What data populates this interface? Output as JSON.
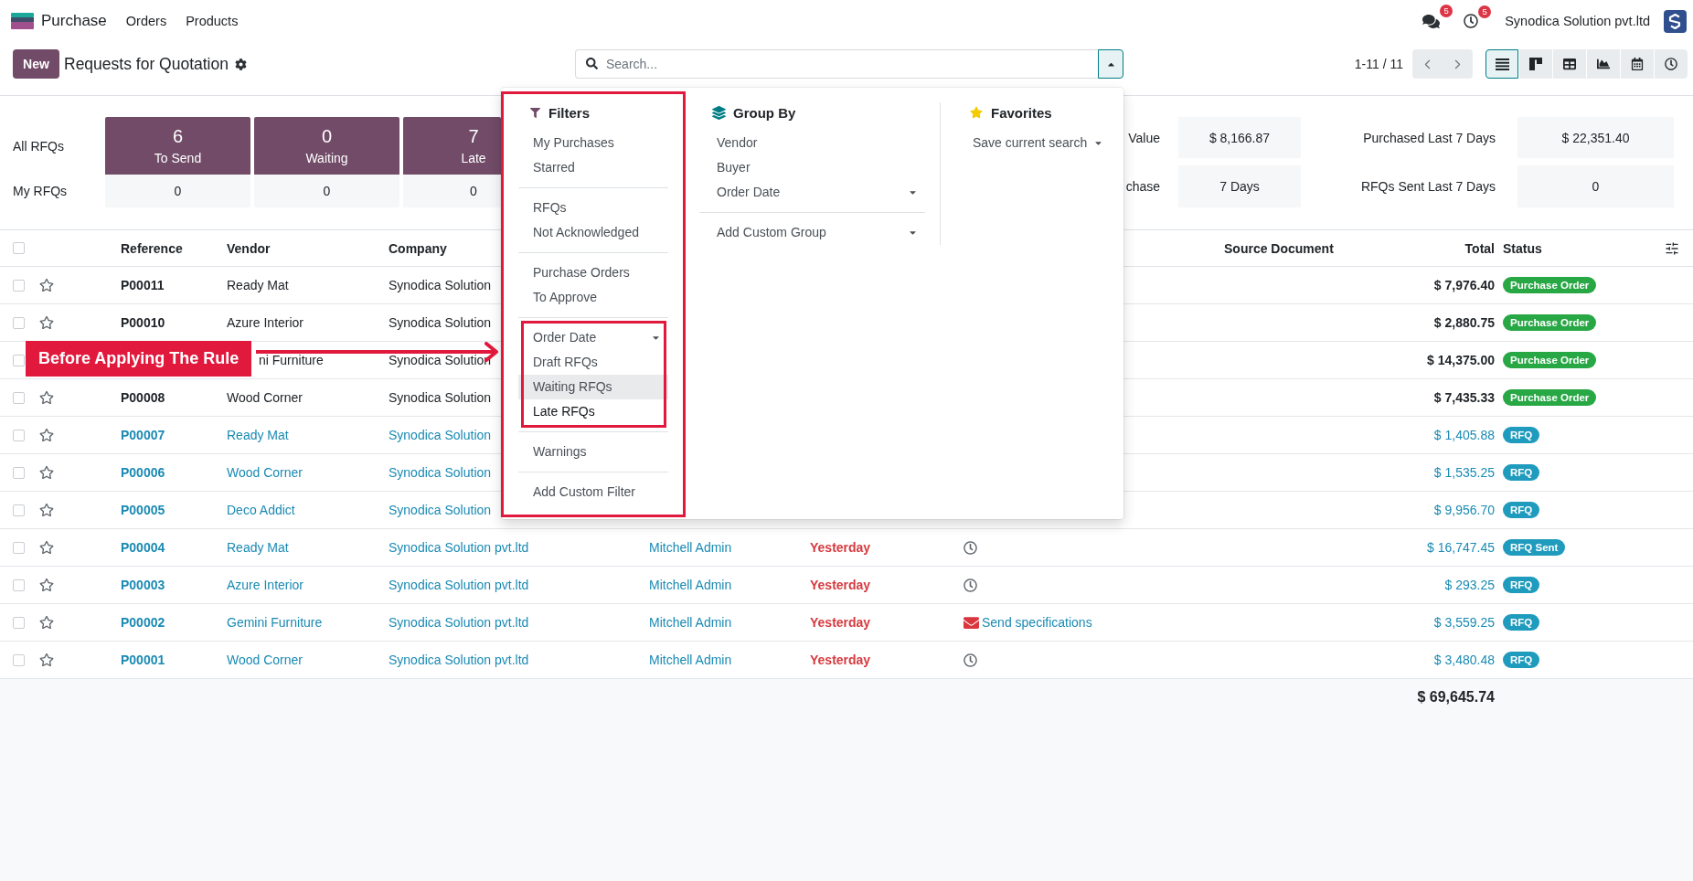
{
  "navbar": {
    "app_name": "Purchase",
    "menu": [
      "Orders",
      "Products"
    ],
    "messages_badge": "5",
    "activities_badge": "5",
    "company": "Synodica Solution pvt.ltd"
  },
  "control_panel": {
    "new_button": "New",
    "title": "Requests for Quotation",
    "search": {
      "placeholder": "Search...",
      "expanded": true
    },
    "pager": "1-11 / 11",
    "views": [
      {
        "kind": "list",
        "selected": true
      },
      {
        "kind": "kanban",
        "selected": false
      },
      {
        "kind": "pivot",
        "selected": false
      },
      {
        "kind": "graph",
        "selected": false
      },
      {
        "kind": "calendar",
        "selected": false
      },
      {
        "kind": "activity",
        "selected": false
      }
    ]
  },
  "dashboard": {
    "all_label": "All RFQs",
    "my_label": "My RFQs",
    "tiles": [
      {
        "count": "6",
        "label": "To Send",
        "mine": "0"
      },
      {
        "count": "0",
        "label": "Waiting",
        "mine": "0"
      },
      {
        "count": "7",
        "label": "Late",
        "mine": "0"
      }
    ],
    "stats": [
      {
        "label": "Value",
        "value": "$ 8,166.87"
      },
      {
        "label": "Purchased Last 7 Days",
        "value": "$ 22,351.40"
      },
      {
        "label": "chase",
        "value": "7 Days"
      },
      {
        "label": "RFQs Sent Last 7 Days",
        "value": "0"
      }
    ]
  },
  "table": {
    "select_all": {
      "checked": false
    },
    "columns": {
      "reference": "Reference",
      "vendor": "Vendor",
      "company": "Company",
      "source_document": "Source Document",
      "total": "Total",
      "status": "Status"
    },
    "rows": [
      {
        "kind": "order",
        "checked": false,
        "starred": false,
        "reference": "P00011",
        "vendor": "Ready Mat",
        "company": "Synodica Solution",
        "total": "$ 7,976.40",
        "status": "Purchase Order"
      },
      {
        "kind": "order",
        "checked": false,
        "starred": false,
        "reference": "P00010",
        "vendor": "Azure Interior",
        "company": "Synodica Solution",
        "total": "$ 2,880.75",
        "status": "Purchase Order"
      },
      {
        "kind": "order",
        "checked": false,
        "vendor": "ni Furniture",
        "company": "Synodica Solution",
        "total": "$ 14,375.00",
        "status": "Purchase Order"
      },
      {
        "kind": "order",
        "checked": false,
        "starred": false,
        "reference": "P00008",
        "vendor": "Wood Corner",
        "company": "Synodica Solution",
        "total": "$ 7,435.33",
        "status": "Purchase Order"
      },
      {
        "kind": "rfq",
        "checked": false,
        "starred": false,
        "reference": "P00007",
        "vendor": "Ready Mat",
        "company": "Synodica Solution",
        "total": "$ 1,405.88",
        "status": "RFQ"
      },
      {
        "kind": "rfq",
        "checked": false,
        "starred": false,
        "reference": "P00006",
        "vendor": "Wood Corner",
        "company": "Synodica Solution",
        "total": "$ 1,535.25",
        "status": "RFQ"
      },
      {
        "kind": "rfq",
        "checked": false,
        "starred": false,
        "reference": "P00005",
        "vendor": "Deco Addict",
        "company": "Synodica Solution",
        "total": "$ 9,956.70",
        "status": "RFQ"
      },
      {
        "kind": "rfq",
        "checked": false,
        "starred": false,
        "reference": "P00004",
        "vendor": "Ready Mat",
        "company": "Synodica Solution pvt.ltd",
        "buyer": "Mitchell Admin",
        "deadline": "Yesterday",
        "activity": {
          "kind": "clock"
        },
        "total": "$ 16,747.45",
        "status": "RFQ Sent"
      },
      {
        "kind": "rfq",
        "checked": false,
        "starred": false,
        "reference": "P00003",
        "vendor": "Azure Interior",
        "company": "Synodica Solution pvt.ltd",
        "buyer": "Mitchell Admin",
        "deadline": "Yesterday",
        "activity": {
          "kind": "clock"
        },
        "total": "$ 293.25",
        "status": "RFQ"
      },
      {
        "kind": "rfq",
        "checked": false,
        "starred": false,
        "reference": "P00002",
        "vendor": "Gemini Furniture",
        "company": "Synodica Solution pvt.ltd",
        "buyer": "Mitchell Admin",
        "deadline": "Yesterday",
        "activity": {
          "kind": "email",
          "summary": "Send specifications"
        },
        "total": "$ 3,559.25",
        "status": "RFQ"
      },
      {
        "kind": "rfq",
        "checked": false,
        "starred": false,
        "reference": "P00001",
        "vendor": "Wood Corner",
        "company": "Synodica Solution pvt.ltd",
        "buyer": "Mitchell Admin",
        "deadline": "Yesterday",
        "activity": {
          "kind": "clock"
        },
        "total": "$ 3,480.48",
        "status": "RFQ"
      }
    ],
    "footer_total": "$ 69,645.74"
  },
  "search_panel": {
    "filters": {
      "title": "Filters",
      "outlined": true,
      "groups": [
        {
          "outlined": false,
          "items": [
            {
              "label": "My Purchases",
              "submenu": false,
              "focused": false,
              "hovered": false
            },
            {
              "label": "Starred",
              "submenu": false,
              "focused": false,
              "hovered": false
            }
          ]
        },
        {
          "outlined": false,
          "items": [
            {
              "label": "RFQs",
              "submenu": false,
              "focused": false,
              "hovered": false
            },
            {
              "label": "Not Acknowledged",
              "submenu": false,
              "focused": false,
              "hovered": false
            }
          ]
        },
        {
          "outlined": false,
          "items": [
            {
              "label": "Purchase Orders",
              "submenu": false,
              "focused": false,
              "hovered": false
            },
            {
              "label": "To Approve",
              "submenu": false,
              "focused": false,
              "hovered": false
            }
          ]
        },
        {
          "outlined": true,
          "items": [
            {
              "label": "Order Date",
              "submenu": true,
              "focused": false,
              "hovered": false
            },
            {
              "label": "Draft RFQs",
              "submenu": false,
              "focused": false,
              "hovered": false
            },
            {
              "label": "Waiting RFQs",
              "submenu": false,
              "focused": true,
              "hovered": false
            },
            {
              "label": "Late RFQs",
              "submenu": false,
              "focused": false,
              "hovered": true
            }
          ]
        },
        {
          "outlined": false,
          "items": [
            {
              "label": "Warnings",
              "submenu": false,
              "focused": false,
              "hovered": false
            }
          ]
        },
        {
          "outlined": false,
          "items": [
            {
              "label": "Add Custom Filter",
              "submenu": false,
              "focused": false,
              "hovered": false
            }
          ]
        }
      ]
    },
    "group_by": {
      "title": "Group By",
      "groups": [
        {
          "items": [
            {
              "label": "Vendor",
              "submenu": false
            },
            {
              "label": "Buyer",
              "submenu": false
            },
            {
              "label": "Order Date",
              "submenu": true
            }
          ]
        },
        {
          "items": [
            {
              "label": "Add Custom Group",
              "submenu": true
            }
          ]
        }
      ]
    },
    "favorites": {
      "title": "Favorites",
      "items": [
        {
          "label": "Save current search",
          "submenu": true
        }
      ]
    }
  },
  "annotation": {
    "label": "Before Applying The Rule"
  }
}
